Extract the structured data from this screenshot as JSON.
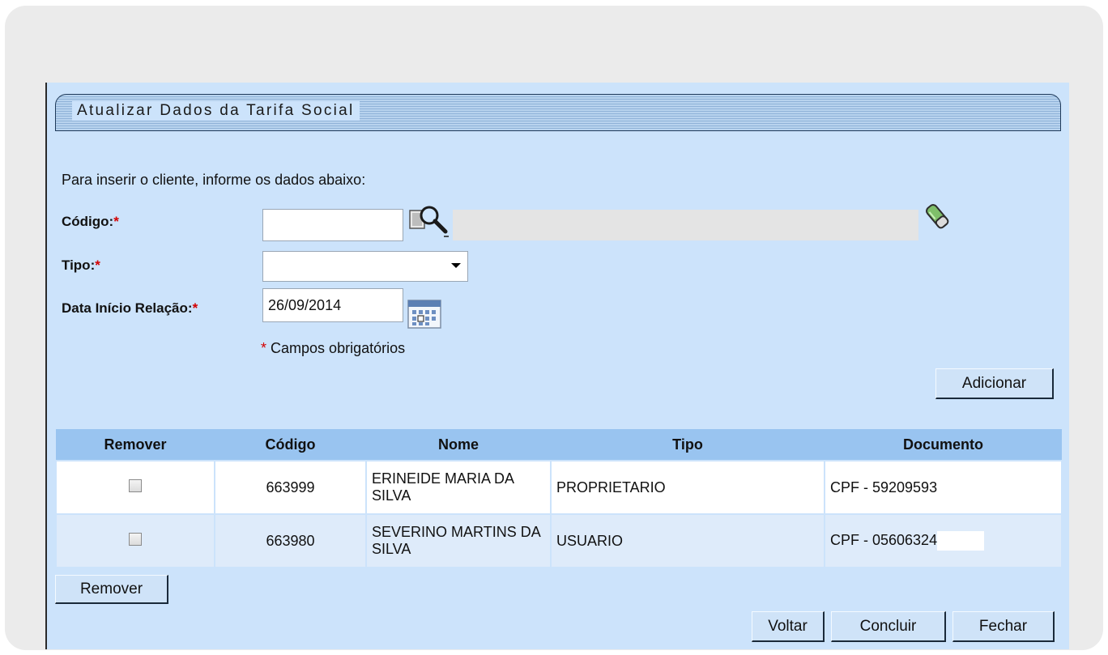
{
  "form": {
    "title": "Atualizar Dados da Tarifa Social",
    "instruction": "Para inserir o cliente, informe os dados abaixo:",
    "codigo_label": "Código:",
    "tipo_label": "Tipo:",
    "data_label": "Data Início Relação:",
    "required_mark": "*",
    "codigo_value": "",
    "tipo_selected": "",
    "data_value": "26/09/2014",
    "required_note": "Campos obrigatórios",
    "add_button": "Adicionar"
  },
  "table": {
    "headers": [
      "Remover",
      "Código",
      "Nome",
      "Tipo",
      "Documento"
    ],
    "rows": [
      {
        "codigo": "663999",
        "nome": "ERINEIDE MARIA DA SILVA",
        "tipo": "PROPRIETARIO",
        "documento": "CPF - 59209593",
        "checked": false
      },
      {
        "codigo": "663980",
        "nome": "SEVERINO MARTINS DA SILVA",
        "tipo": "USUARIO",
        "documento": "CPF - 05606324",
        "checked": false
      }
    ]
  },
  "buttons": {
    "remove": "Remover",
    "back": "Voltar",
    "finish": "Concluir",
    "close": "Fechar"
  },
  "icons": {
    "search": "magnifier-search-icon",
    "clear": "eraser-icon",
    "calendar": "calendar-icon"
  }
}
